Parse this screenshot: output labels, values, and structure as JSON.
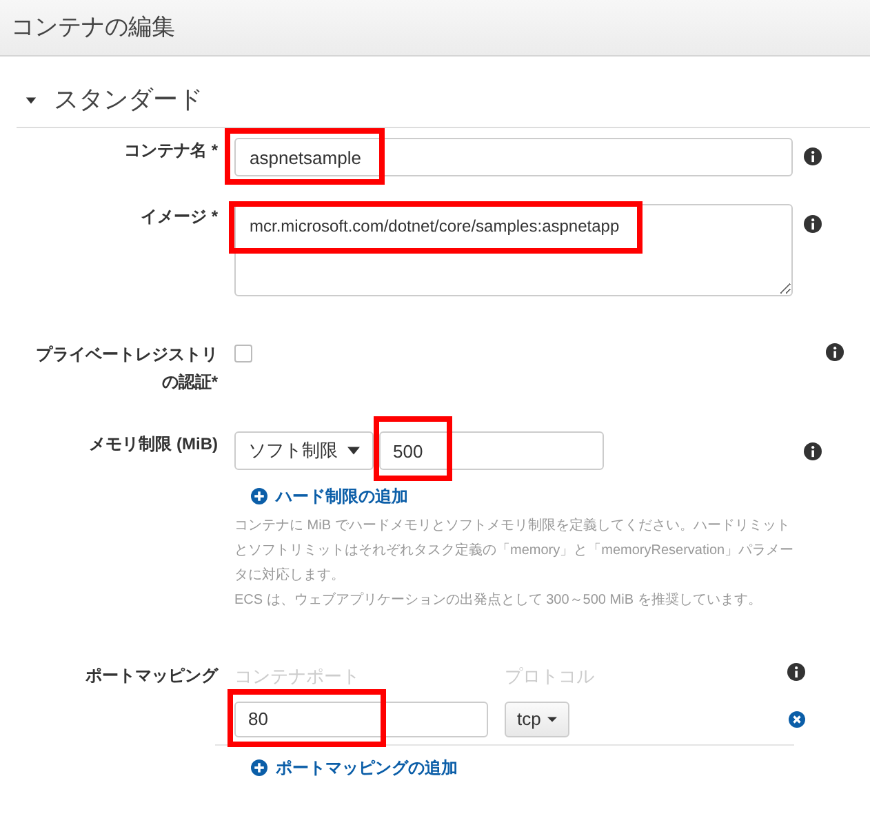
{
  "header": {
    "title": "コンテナの編集"
  },
  "section": {
    "title": "スタンダード",
    "expanded": true
  },
  "container_name": {
    "label": "コンテナ名",
    "required": "*",
    "value": "aspnetsample",
    "highlighted": true
  },
  "image": {
    "label": "イメージ",
    "required": "*",
    "value": "mcr.microsoft.com/dotnet/core/samples:aspnetapp",
    "highlighted": true
  },
  "private_registry": {
    "label_lines": [
      "プライベートレジストリ",
      "の認証*"
    ],
    "checked": false
  },
  "memory": {
    "label": "メモリ制限 (MiB)",
    "limit_type": "ソフト制限",
    "value": "500",
    "highlighted": true,
    "add_link": "ハード制限の追加",
    "help": [
      "コンテナに MiB でハードメモリとソフトメモリ制限を定義してください。ハードリミットとソフトリミットはそれぞれタスク定義の「memory」と「memoryReservation」パラメータに対応します。",
      "ECS は、ウェブアプリケーションの出発点として 300～500 MiB を推奨しています。"
    ]
  },
  "port_mapping": {
    "label": "ポートマッピング",
    "columns": [
      "コンテナポート",
      "プロトコル"
    ],
    "rows": [
      {
        "container_port": "80",
        "protocol": "tcp",
        "highlighted": true
      }
    ],
    "add_link": "ポートマッピングの追加"
  }
}
